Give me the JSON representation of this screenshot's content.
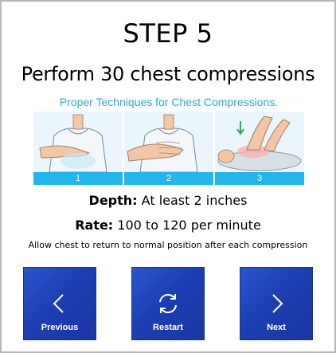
{
  "step": {
    "title": "STEP 5"
  },
  "instruction": "Perform 30 chest compressions",
  "illustration": {
    "caption": "Proper Techniques for Chest Compressions.",
    "panels": [
      {
        "number": "1"
      },
      {
        "number": "2"
      },
      {
        "number": "3"
      }
    ]
  },
  "facts": {
    "depth": {
      "label": "Depth:",
      "value": "At least 2 inches"
    },
    "rate": {
      "label": "Rate:",
      "value": "100 to 120 per minute"
    }
  },
  "note": "Allow chest to return to normal position after each compression",
  "nav": {
    "previous": {
      "label": "Previous",
      "icon": "chevron-left-icon"
    },
    "restart": {
      "label": "Restart",
      "icon": "refresh-icon"
    },
    "next": {
      "label": "Next",
      "icon": "chevron-right-icon"
    }
  },
  "colors": {
    "button": "#1f44b8",
    "caption": "#2aa8e0",
    "panel_bar": "#22b7e8",
    "frame_border": "#b8b8b8"
  }
}
